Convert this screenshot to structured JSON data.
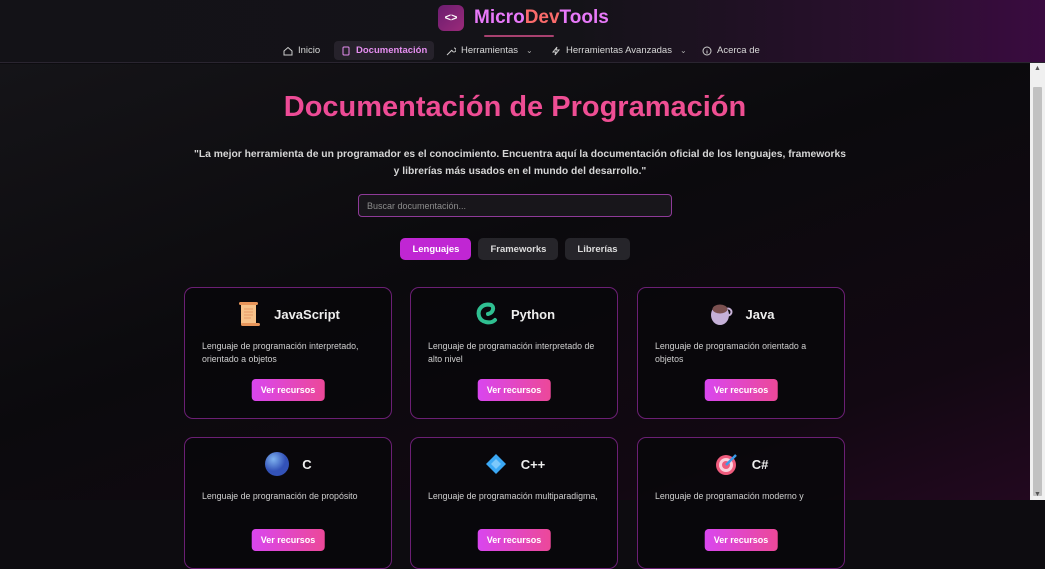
{
  "brand": {
    "prefix": "Micro",
    "middle": "Dev",
    "suffix": "Tools",
    "logo_icon": "code-icon"
  },
  "nav": [
    {
      "label": "Inicio",
      "icon": "home-icon"
    },
    {
      "label": "Documentación",
      "icon": "book-icon",
      "active": true
    },
    {
      "label": "Herramientas",
      "icon": "wrench-icon",
      "dropdown": true
    },
    {
      "label": "Herramientas Avanzadas",
      "icon": "bolt-icon",
      "dropdown": true
    },
    {
      "label": "Acerca de",
      "icon": "info-icon"
    }
  ],
  "page": {
    "title": "Documentación de Programación",
    "quote": "\"La mejor herramienta de un programador es el conocimiento. Encuentra aquí la documentación oficial de los lenguajes, frameworks y librerías más usados en el mundo del desarrollo.\"",
    "search_placeholder": "Buscar documentación..."
  },
  "tabs": [
    {
      "label": "Lenguajes",
      "active": true
    },
    {
      "label": "Frameworks"
    },
    {
      "label": "Librerías"
    }
  ],
  "cards": [
    {
      "name": "JavaScript",
      "desc": "Lenguaje de programación interpretado, orientado a objetos",
      "button": "Ver recursos",
      "icon": "scroll-icon"
    },
    {
      "name": "Python",
      "desc": "Lenguaje de programación interpretado de alto nivel",
      "button": "Ver recursos",
      "icon": "snake-icon"
    },
    {
      "name": "Java",
      "desc": "Lenguaje de programación orientado a objetos",
      "button": "Ver recursos",
      "icon": "coffee-icon"
    },
    {
      "name": "C",
      "desc": "Lenguaje de programación de propósito",
      "button": "Ver recursos",
      "icon": "blue-circle-icon"
    },
    {
      "name": "C++",
      "desc": "Lenguaje de programación multiparadigma,",
      "button": "Ver recursos",
      "icon": "diamond-icon"
    },
    {
      "name": "C#",
      "desc": "Lenguaje de programación moderno y",
      "button": "Ver recursos",
      "icon": "target-icon"
    }
  ]
}
